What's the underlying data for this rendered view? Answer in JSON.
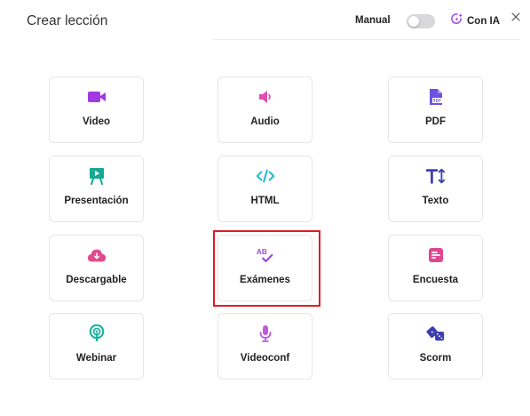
{
  "header": {
    "title": "Crear lección",
    "manual_label": "Manual",
    "ai_label": "Con IA"
  },
  "cards": [
    {
      "id": "video",
      "label": "Video",
      "icon": "video-camera-icon",
      "color": "#a238e0"
    },
    {
      "id": "audio",
      "label": "Audio",
      "icon": "speaker-icon",
      "color": "#e04bb0"
    },
    {
      "id": "pdf",
      "label": "PDF",
      "icon": "pdf-file-icon",
      "color": "#6d52e0"
    },
    {
      "id": "presentacion",
      "label": "Presentación",
      "icon": "presentation-easel-icon",
      "color": "#17a892"
    },
    {
      "id": "html",
      "label": "HTML",
      "icon": "code-brackets-icon",
      "color": "#1fb8d4"
    },
    {
      "id": "texto",
      "label": "Texto",
      "icon": "text-size-icon",
      "color": "#3d3fb0"
    },
    {
      "id": "descargable",
      "label": "Descargable",
      "icon": "cloud-download-icon",
      "color": "#e04b8e"
    },
    {
      "id": "examenes",
      "label": "Exámenes",
      "icon": "ab-check-icon",
      "color": "#a045e0"
    },
    {
      "id": "encuesta",
      "label": "Encuesta",
      "icon": "survey-list-icon",
      "color": "#e0478e"
    },
    {
      "id": "webinar",
      "label": "Webinar",
      "icon": "broadcast-icon",
      "color": "#17b5a0"
    },
    {
      "id": "videoconf",
      "label": "Videoconf",
      "icon": "microphone-icon",
      "color": "#c05ae0"
    },
    {
      "id": "scorm",
      "label": "Scorm",
      "icon": "dice-icon",
      "color": "#3d3fb0"
    }
  ],
  "colors": {
    "ai_accent": "#9b4be8",
    "highlight": "#e01b24",
    "toggle_off": "#d7d7dc"
  }
}
